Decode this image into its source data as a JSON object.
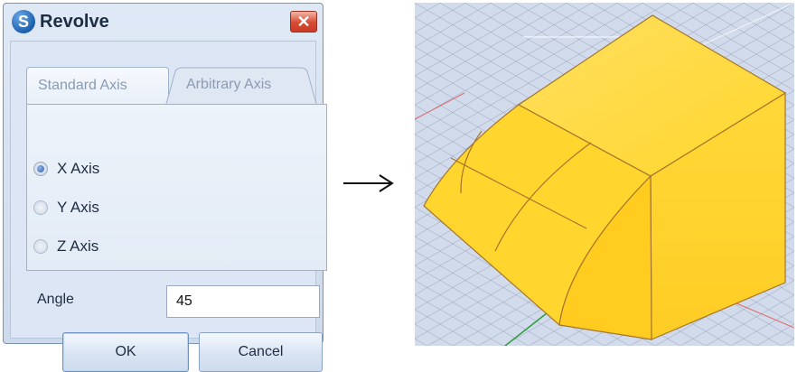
{
  "dialog": {
    "title": "Revolve",
    "app_icon_letter": "S",
    "close_glyph": "✕",
    "tabs": [
      {
        "label": "Standard Axis",
        "active": true
      },
      {
        "label": "Arbitrary Axis",
        "active": false
      }
    ],
    "axes": [
      {
        "label": "X Axis",
        "checked": true,
        "enabled": true
      },
      {
        "label": "Y Axis",
        "checked": false,
        "enabled": false
      },
      {
        "label": "Z Axis",
        "checked": false,
        "enabled": false
      }
    ],
    "angle_label": "Angle",
    "angle_value": "45",
    "ok_label": "OK",
    "cancel_label": "Cancel"
  },
  "arrow_icon": "right-arrow-icon",
  "viewport": {
    "description_icon": "revolved-solid-preview",
    "colors": {
      "grid_background": "#d2dbeb",
      "grid_line": "#6f7f99",
      "solid_fill": "#ffd633",
      "solid_edge": "#a4752c"
    }
  }
}
